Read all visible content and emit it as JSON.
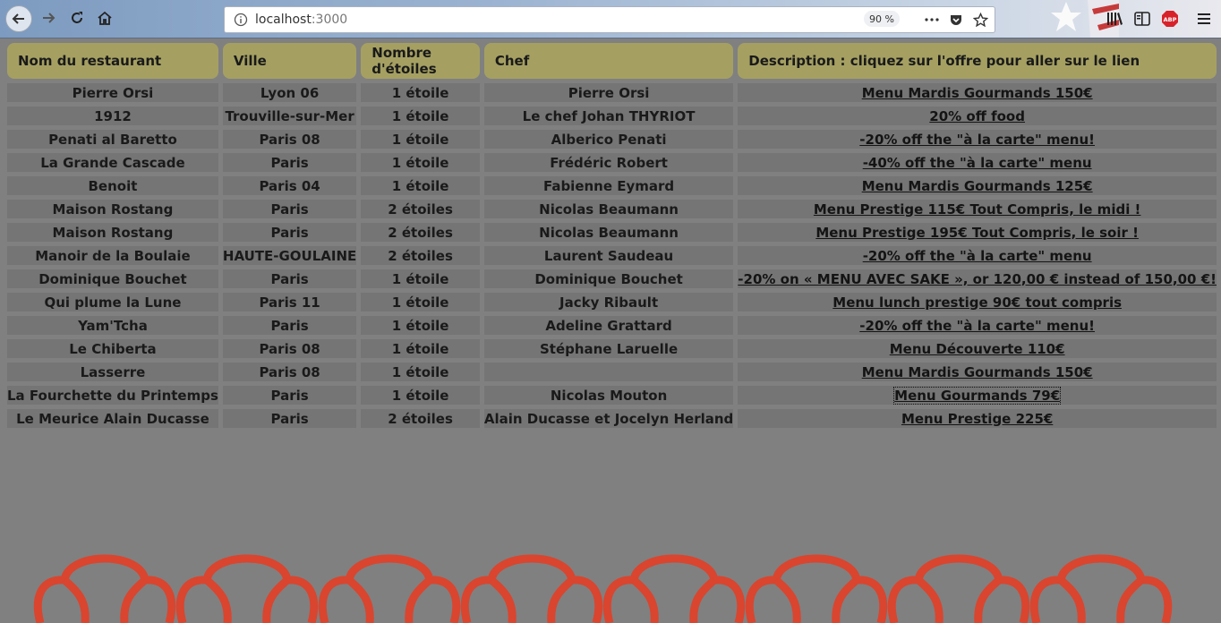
{
  "browser": {
    "url_host": "localhost",
    "url_port": ":3000",
    "zoom": "90 %",
    "icons": [
      "back-icon",
      "forward-icon",
      "reload-icon",
      "home-icon",
      "info-icon",
      "more-icon",
      "pocket-icon",
      "bookmark-star-icon",
      "library-icon",
      "sidebar-icon",
      "adblock-icon",
      "menu-icon"
    ],
    "adblock_label": "ABP"
  },
  "table": {
    "headers": [
      "Nom du restaurant",
      "Ville",
      "Nombre d'étoiles",
      "Chef",
      "Description : cliquez sur l'offre pour aller sur le lien"
    ],
    "rows": [
      {
        "name": "Pierre Orsi",
        "city": "Lyon 06",
        "stars": "1 étoile",
        "chef": "Pierre Orsi",
        "offer": "Menu Mardis Gourmands 150€"
      },
      {
        "name": "1912",
        "city": "Trouville-sur-Mer",
        "stars": "1 étoile",
        "chef": "Le chef Johan THYRIOT",
        "offer": "20% off food"
      },
      {
        "name": "Penati al Baretto",
        "city": "Paris 08",
        "stars": "1 étoile",
        "chef": "Alberico Penati",
        "offer": "-20% off the \"à la carte\" menu!"
      },
      {
        "name": "La Grande Cascade",
        "city": "Paris",
        "stars": "1 étoile",
        "chef": "Frédéric Robert",
        "offer": "-40% off the \"à la carte\" menu"
      },
      {
        "name": "Benoit",
        "city": "Paris 04",
        "stars": "1 étoile",
        "chef": "Fabienne Eymard",
        "offer": "Menu Mardis Gourmands 125€"
      },
      {
        "name": "Maison Rostang",
        "city": "Paris",
        "stars": "2 étoiles",
        "chef": "Nicolas Beaumann",
        "offer": "Menu Prestige 115€ Tout Compris, le midi !"
      },
      {
        "name": "Maison Rostang",
        "city": "Paris",
        "stars": "2 étoiles",
        "chef": "Nicolas Beaumann",
        "offer": "Menu Prestige 195€ Tout Compris, le soir !"
      },
      {
        "name": "Manoir de la Boulaie",
        "city": "HAUTE-GOULAINE",
        "stars": "2 étoiles",
        "chef": "Laurent Saudeau",
        "offer": "-20% off the \"à la carte\" menu"
      },
      {
        "name": "Dominique Bouchet",
        "city": "Paris",
        "stars": "1 étoile",
        "chef": "Dominique Bouchet",
        "offer": "-20% on « MENU AVEC SAKE », or 120,00 € instead of 150,00 €!"
      },
      {
        "name": "Qui plume la Lune",
        "city": "Paris 11",
        "stars": "1 étoile",
        "chef": "Jacky Ribault",
        "offer": "Menu lunch prestige 90€ tout compris"
      },
      {
        "name": "Yam'Tcha",
        "city": "Paris",
        "stars": "1 étoile",
        "chef": "Adeline Grattard",
        "offer": "-20% off the \"à la carte\" menu!"
      },
      {
        "name": "Le Chiberta",
        "city": "Paris 08",
        "stars": "1 étoile",
        "chef": "Stéphane Laruelle",
        "offer": "Menu Découverte 110€"
      },
      {
        "name": "Lasserre",
        "city": "Paris 08",
        "stars": "1 étoile",
        "chef": "",
        "offer": "Menu Mardis Gourmands 150€"
      },
      {
        "name": "La Fourchette du Printemps",
        "city": "Paris",
        "stars": "1 étoile",
        "chef": "Nicolas Mouton",
        "offer": "Menu Gourmands 79€",
        "selected": true
      },
      {
        "name": "Le Meurice Alain Ducasse",
        "city": "Paris",
        "stars": "2 étoiles",
        "chef": "Alain Ducasse et Jocelyn Herland",
        "offer": "Menu Prestige 225€"
      }
    ]
  },
  "colors": {
    "page_bg": "#808080",
    "header_bg": "#a5a062",
    "cell_bg": "#757575",
    "pattern": "#d9452f"
  }
}
